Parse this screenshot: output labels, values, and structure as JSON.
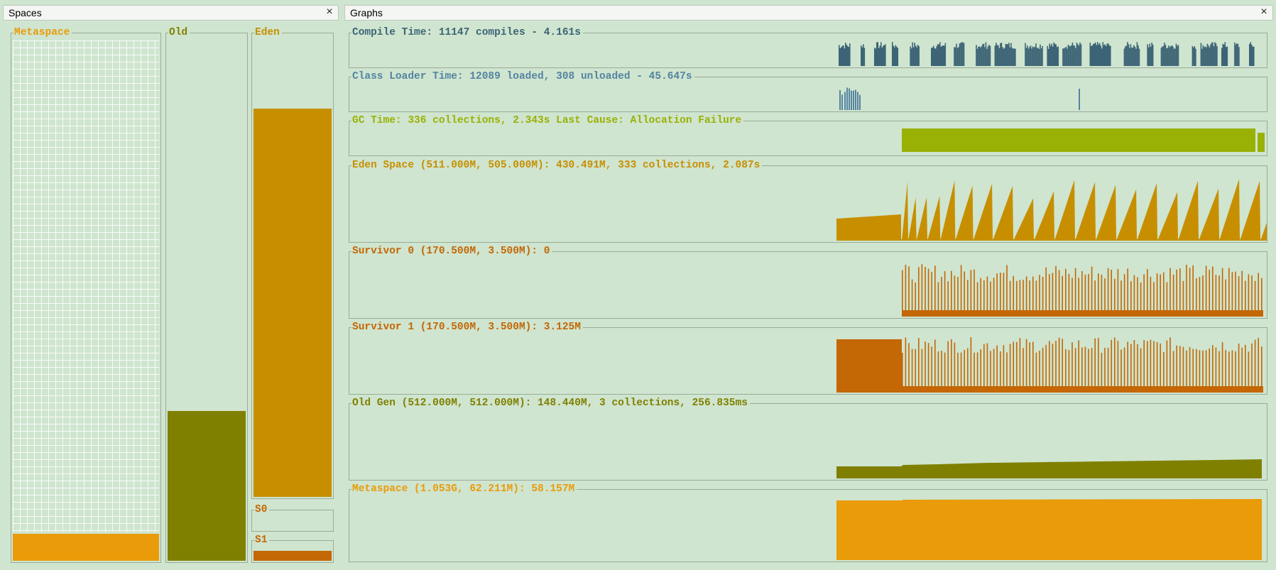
{
  "spaces_panel": {
    "title": "Spaces",
    "close": "×"
  },
  "graphs_panel": {
    "title": "Graphs",
    "close": "×"
  },
  "spaces": {
    "metaspace": {
      "label": "Metaspace",
      "color": "#e99b0a",
      "fill_ratio": 0.055
    },
    "old": {
      "label": "Old",
      "color": "#808000",
      "fill_ratio": 0.29
    },
    "eden": {
      "label": "Eden",
      "color": "#c78f00",
      "fill_ratio": 0.843
    },
    "s0": {
      "label": "S0",
      "color": "#c46705",
      "fill_ratio": 0.0
    },
    "s1": {
      "label": "S1",
      "color": "#c46705",
      "fill_ratio": 0.89
    }
  },
  "graphs": [
    {
      "key": "compile",
      "title": "Compile Time: 11147 compiles - 4.161s",
      "color": "#3d6476"
    },
    {
      "key": "classloader",
      "title": "Class Loader Time: 12089 loaded, 308 unloaded - 45.647s",
      "color": "#5583a1"
    },
    {
      "key": "gc",
      "title": "GC Time: 336 collections, 2.343s  Last Cause: Allocation Failure",
      "color": "#99b104"
    },
    {
      "key": "eden",
      "title": "Eden Space (511.000M, 505.000M): 430.491M, 333 collections, 2.087s",
      "color": "#c78f00"
    },
    {
      "key": "s0",
      "title": "Survivor 0 (170.500M, 3.500M): 0",
      "color": "#c46705"
    },
    {
      "key": "s1",
      "title": "Survivor 1 (170.500M, 3.500M): 3.125M",
      "color": "#c46705"
    },
    {
      "key": "old",
      "title": "Old Gen (512.000M, 512.000M): 148.440M, 3 collections, 256.835ms",
      "color": "#808000"
    },
    {
      "key": "metaspace",
      "title": "Metaspace (1.053G, 62.211M): 58.157M",
      "color": "#e99b0a"
    }
  ]
}
